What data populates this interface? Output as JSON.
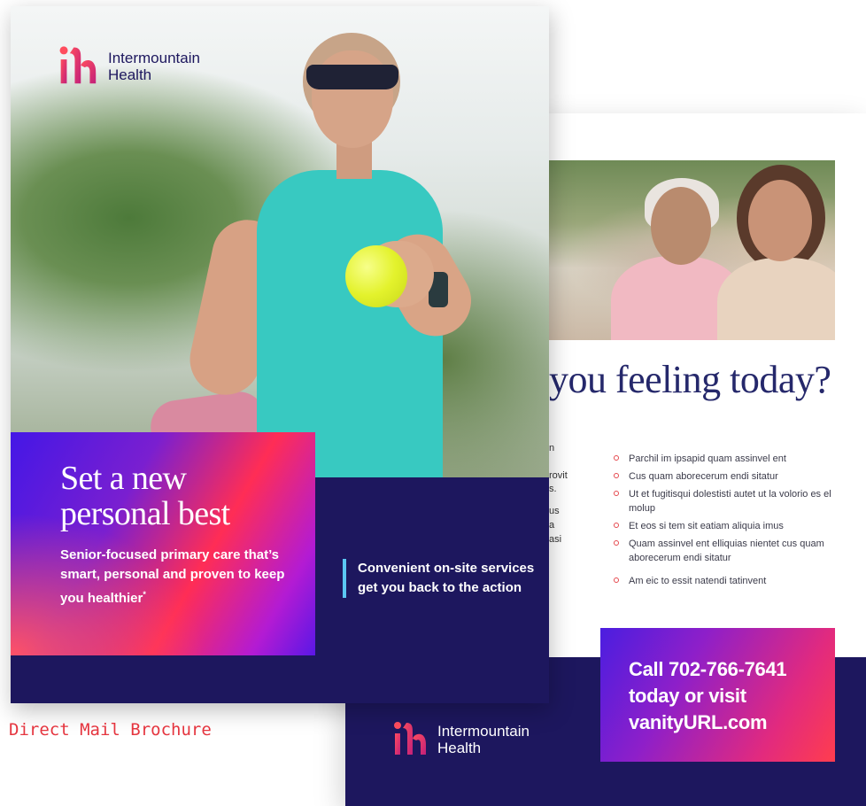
{
  "brand": {
    "name_line1": "Intermountain",
    "name_line2": "Health",
    "logo_mark": "ih",
    "colors": {
      "navy": "#1d175e",
      "magenta": "#e22a7e",
      "violet": "#4b1ee0",
      "coral": "#ff3d4e",
      "accent_blue": "#5bc6f3",
      "caption_red": "#e5353f"
    }
  },
  "front": {
    "headline_line1": "Set a new",
    "headline_line2": "personal best",
    "subhead": "Senior-focused primary care that’s smart, personal and proven to keep you healthier",
    "subhead_mark": "*",
    "callout": "Convenient on-site services get you back to the action"
  },
  "back": {
    "heading": "you feeling today?",
    "fragments": [
      "n",
      "rovit",
      "s.",
      "us",
      "a",
      "asi"
    ],
    "bullets": [
      "Parchil im ipsapid quam assinvel ent",
      "Cus quam aborecerum endi sitatur",
      "Ut et fugitisqui dolestisti autet ut la volorio es el molup",
      "Et eos si tem sit eatiam aliquia imus",
      "Quam assinvel ent elliquias nientet cus quam aborecerum endi sitatur",
      "Am eic to essit natendi tatinvent"
    ],
    "cta_line1": "Call 702-766-7641",
    "cta_line2": "today or visit",
    "cta_line3": "vanityURL.com"
  },
  "caption": "Direct Mail Brochure"
}
